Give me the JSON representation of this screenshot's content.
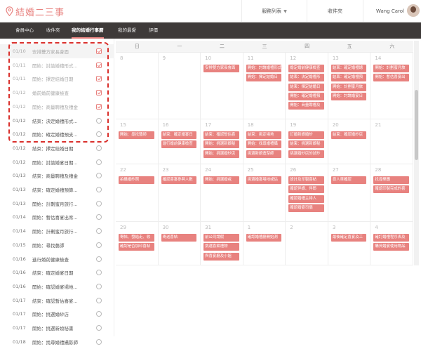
{
  "app": {
    "logo": "結婚二三事"
  },
  "header": {
    "menu": "服務列表",
    "inbox": "收件夾",
    "user": "Wang  Carol"
  },
  "nav": [
    "會員中心",
    "收件夾",
    "我的結婚行事曆",
    "我的最愛",
    "評價"
  ],
  "tasks": [
    {
      "date": "01/10",
      "text": "安排雙方家長會面",
      "done": true
    },
    {
      "date": "01/11",
      "text": "開始：討論婚禮形式...",
      "done": true
    },
    {
      "date": "01/11",
      "text": "開始：擇定結婚日期",
      "done": true
    },
    {
      "date": "01/12",
      "text": "婚前婚前健康檢查",
      "done": true
    },
    {
      "date": "01/12",
      "text": "開始：商量聘禮及禮金",
      "done": true
    },
    {
      "date": "01/12",
      "text": "結束：決定婚禮形式...",
      "done": false
    },
    {
      "date": "01/12",
      "text": "開始：確定婚禮預支...",
      "done": false
    },
    {
      "date": "01/12",
      "text": "結束：擇定結婚日期",
      "done": false
    },
    {
      "date": "01/12",
      "text": "開始：討論婚宴日期...",
      "done": false
    },
    {
      "date": "01/13",
      "text": "結束：商量聘禮及禮金",
      "done": false
    },
    {
      "date": "01/13",
      "text": "結束：確定婚禮預算...",
      "done": false
    },
    {
      "date": "01/13",
      "text": "開始：計劃蜜月旅行...",
      "done": false
    },
    {
      "date": "01/14",
      "text": "開始：暫估喜宴出席...",
      "done": false
    },
    {
      "date": "01/14",
      "text": "開始：計劃蜜月旅行...",
      "done": false
    },
    {
      "date": "01/15",
      "text": "開始：尋找藝師",
      "done": false
    },
    {
      "date": "01/16",
      "text": "進行婚前健康檢查",
      "done": false
    },
    {
      "date": "01/16",
      "text": "結束：確定婚宴日期",
      "done": false
    },
    {
      "date": "01/16",
      "text": "開始：確認婚宴場地...",
      "done": false
    },
    {
      "date": "01/17",
      "text": "結束：確認暫估喜宴...",
      "done": false
    },
    {
      "date": "01/17",
      "text": "開始：挑選婚紗店",
      "done": false
    },
    {
      "date": "01/17",
      "text": "開始：挑選新娘秘書",
      "done": false
    },
    {
      "date": "01/18",
      "text": "開始：找尋婚禮攝影師",
      "done": false
    }
  ],
  "calendar": {
    "weekdays": [
      "日",
      "一",
      "二",
      "三",
      "四",
      "五",
      "六"
    ],
    "weeks": [
      [
        {
          "d": "8",
          "ev": []
        },
        {
          "d": "9",
          "ev": []
        },
        {
          "d": "10",
          "ev": [
            "安排雙方家長會面"
          ]
        },
        {
          "d": "11",
          "ev": [
            "開始：討論婚禮形式",
            "開始：擇定結婚日"
          ]
        },
        {
          "d": "12",
          "ev": [
            "婚定婚前健康檢查",
            "結束：決定婚禮形",
            "結束：擇定結婚日",
            "開始：確定婚禮預",
            "開始：商量聘禮及"
          ]
        },
        {
          "d": "13",
          "ev": [
            "結束：確定婚禮總",
            "結束：確定婚禮預",
            "開始：計劃蜜月旅",
            "開始：討論婚宴日"
          ]
        },
        {
          "d": "14",
          "ev": [
            "開始：計劃蜜月旅",
            "開始：暫估喜宴出"
          ]
        }
      ],
      [
        {
          "d": "15",
          "ev": [
            "開始：尋找藝師"
          ]
        },
        {
          "d": "16",
          "ev": [
            "結束：確定婚宴日",
            "進行婚前健康檢查"
          ]
        },
        {
          "d": "17",
          "ev": [
            "結束：確認暫估喜",
            "開始：挑選新娘秘",
            "開始：挑選婚紗店"
          ]
        },
        {
          "d": "18",
          "ev": [
            "結束：挑定場地",
            "開始：找尋婚禮攝",
            "挑選新娘造型師"
          ]
        },
        {
          "d": "19",
          "ev": [
            "訂婚新娘婚紗",
            "結束：挑選新娘秘",
            "挑選婚紗店的試紗"
          ]
        },
        {
          "d": "20",
          "ev": [
            "結束：確認婚紗店"
          ]
        },
        {
          "d": "21",
          "ev": []
        }
      ],
      [
        {
          "d": "22",
          "ev": [
            "拍攝婚紗照"
          ]
        },
        {
          "d": "23",
          "ev": [
            "確認喜宴參與人數"
          ]
        },
        {
          "d": "24",
          "ev": [
            "開始：挑選婚戒"
          ]
        },
        {
          "d": "25",
          "ev": [
            "挑選婚宴場地或估"
          ]
        },
        {
          "d": "26",
          "ev": [
            "設計及印製喜帖",
            "確認伴娘、伴郎",
            "確認婚禮主持人",
            "確認婚宴司儀"
          ]
        },
        {
          "d": "27",
          "ev": [
            "尋人車確認"
          ]
        },
        {
          "d": "28",
          "ev": [
            "找尋樂團",
            "確認印製完成的喜"
          ]
        }
      ],
      [
        {
          "d": "29",
          "ev": [
            "寄帖、發給走、收",
            "確認是否加印喜帖"
          ]
        },
        {
          "d": "30",
          "ev": [
            "寄送喜帖"
          ]
        },
        {
          "d": "31",
          "ev": [
            "前公司請假",
            "挑選喜餅禮物",
            "與喜宴廳及小姐"
          ]
        },
        {
          "d": "1",
          "ev": [
            "確認婚禮廳開始測"
          ]
        },
        {
          "d": "2",
          "ev": []
        },
        {
          "d": "3",
          "ev": [
            "最後確定喜宴及工"
          ]
        },
        {
          "d": "4",
          "ev": [
            "確訂婚禮程序表及",
            "購買婚宴使用物品"
          ]
        }
      ]
    ]
  },
  "colors": {
    "accent": "#e8827f",
    "nav_bg": "#3e3a39"
  }
}
